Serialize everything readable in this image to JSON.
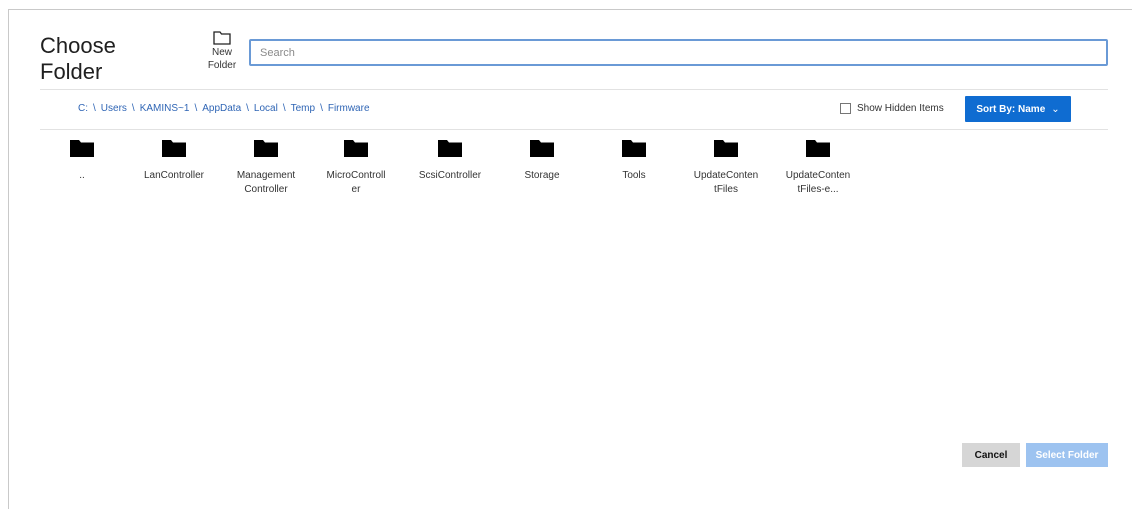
{
  "dialog": {
    "title": "Choose Folder"
  },
  "toolbar": {
    "new_folder_label": "New Folder",
    "new_folder_icon": "folder-outline-icon"
  },
  "search": {
    "placeholder": "Search",
    "value": ""
  },
  "breadcrumb": [
    "C:",
    "Users",
    "KAMINS~1",
    "AppData",
    "Local",
    "Temp",
    "Firmware"
  ],
  "options": {
    "show_hidden_label": "Show Hidden Items",
    "show_hidden_checked": false
  },
  "sort": {
    "label": "Sort By: Name",
    "chevron": "⌄"
  },
  "folders": [
    {
      "name": "..",
      "icon": "folder-icon"
    },
    {
      "name": "LanController",
      "icon": "folder-icon"
    },
    {
      "name": "Management Controller",
      "icon": "folder-icon"
    },
    {
      "name": "MicroController",
      "icon": "folder-icon"
    },
    {
      "name": "ScsiController",
      "icon": "folder-icon"
    },
    {
      "name": "Storage",
      "icon": "folder-icon"
    },
    {
      "name": "Tools",
      "icon": "folder-icon"
    },
    {
      "name": "UpdateContentFiles",
      "icon": "folder-icon"
    },
    {
      "name": "UpdateContentFiles-e...",
      "icon": "folder-icon"
    }
  ],
  "actions": {
    "cancel_label": "Cancel",
    "select_label": "Select Folder"
  },
  "colors": {
    "accent": "#0f6cd1",
    "link": "#2f65b5",
    "disabled_primary": "#9dc3f0",
    "secondary": "#d6d6d6"
  }
}
